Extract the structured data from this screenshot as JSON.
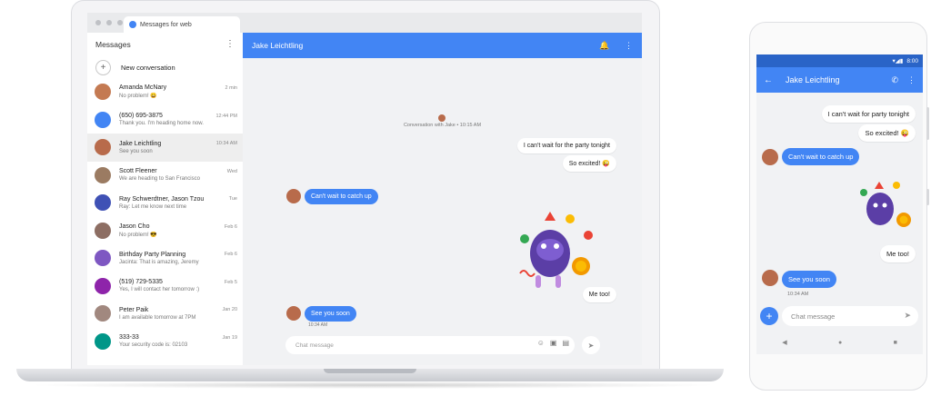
{
  "browser": {
    "tab_title": "Messages for web"
  },
  "sidebar": {
    "title": "Messages",
    "menu_icon": "more-vert-icon",
    "new_conversation": "New conversation",
    "conversations": [
      {
        "name": "Amanda McNary",
        "preview": "No problem! 😀",
        "time": "2 min",
        "avatar_color": "#c47a52"
      },
      {
        "name": "(650) 695-3875",
        "preview": "Thank you. I'm heading home now.",
        "time": "12:44 PM",
        "avatar_color": "#4285f4"
      },
      {
        "name": "Jake Leichtling",
        "preview": "See you soon",
        "time": "10:34 AM",
        "avatar_color": "#b86b4b"
      },
      {
        "name": "Scott Fleener",
        "preview": "We are heading to San Francisco",
        "time": "Wed",
        "avatar_color": "#9b7b62"
      },
      {
        "name": "Ray Schwerdtner, Jason Tzou",
        "preview": "Ray: Let me know next time",
        "time": "Tue",
        "avatar_color": "#3f51b5"
      },
      {
        "name": "Jason Cho",
        "preview": "No problem! 😎",
        "time": "Feb 6",
        "avatar_color": "#8d6e63"
      },
      {
        "name": "Birthday Party Planning",
        "preview": "Jacinta: That is amazing, Jeremy",
        "time": "Feb 6",
        "avatar_color": "#7e57c2"
      },
      {
        "name": "(519) 729-5335",
        "preview": "Yes, I will contact her tomorrow :)",
        "time": "Feb 5",
        "avatar_color": "#8e24aa"
      },
      {
        "name": "Peter Paik",
        "preview": "I am available tomorrow at 7PM",
        "time": "Jan 20",
        "avatar_color": "#a1887f"
      },
      {
        "name": "333-33",
        "preview": "Your security code is: 02103",
        "time": "Jan 19",
        "avatar_color": "#009688"
      }
    ]
  },
  "conversation": {
    "contact": "Jake Leichtling",
    "header_icons": [
      "bell-icon",
      "more-vert-icon"
    ],
    "system_note": "Conversation with Jake • 10:15 AM",
    "messages": [
      {
        "dir": "out",
        "text": "I can't wait for the party tonight"
      },
      {
        "dir": "out",
        "text": "So excited! 😜"
      },
      {
        "dir": "in",
        "text": "Can't wait to catch up"
      },
      {
        "dir": "out",
        "text": "Me too!"
      },
      {
        "dir": "in",
        "text": "See you soon",
        "time": "10:34 AM"
      }
    ],
    "composer_placeholder": "Chat message",
    "composer_icons": [
      "emoji-icon",
      "sticker-icon",
      "image-icon",
      "send-icon"
    ]
  },
  "phone": {
    "status_time": "8:00",
    "contact": "Jake Leichtling",
    "messages": [
      {
        "dir": "out",
        "text": "I can't wait for party tonight"
      },
      {
        "dir": "out",
        "text": "So excited! 😜"
      },
      {
        "dir": "in",
        "text": "Can't wait to catch up"
      },
      {
        "dir": "out",
        "text": "Me too!"
      },
      {
        "dir": "in",
        "text": "See you soon",
        "time": "10:34 AM"
      }
    ],
    "composer_placeholder": "Chat message"
  },
  "colors": {
    "accent": "#4285f4",
    "status_bar": "#2a64c7",
    "background": "#f1f2f4"
  }
}
